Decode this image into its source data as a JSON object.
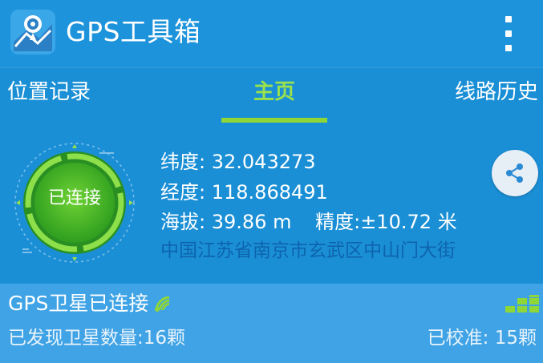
{
  "app": {
    "title": "GPS工具箱"
  },
  "tabs": [
    {
      "label": "位置记录"
    },
    {
      "label": "主页"
    },
    {
      "label": "线路历史"
    }
  ],
  "gauge": {
    "status_label": "已连接"
  },
  "location": {
    "latitude_label": "纬度:",
    "latitude_value": "32.043273",
    "longitude_label": "经度:",
    "longitude_value": "118.868491",
    "altitude_label": "海拔:",
    "altitude_value": "39.86 m",
    "accuracy_label": "精度:",
    "accuracy_value": "±10.72 米",
    "address": "中国江苏省南京市玄武区中山门大街"
  },
  "satellite": {
    "title": "GPS卫星已连接",
    "found_count": "已发现卫星数量:16颗",
    "calibrated": "已校准: 15颗"
  },
  "icons": {
    "app": "gps-app-icon",
    "menu": "overflow-menu-icon",
    "share": "share-icon",
    "satellite": "satellite-dish-icon",
    "signal": "signal-bars-icon"
  },
  "colors": {
    "accent": "#8fd639",
    "background": "#1a8fd6",
    "address": "#0d64ad",
    "satellite_panel": "#3fa3e6"
  }
}
